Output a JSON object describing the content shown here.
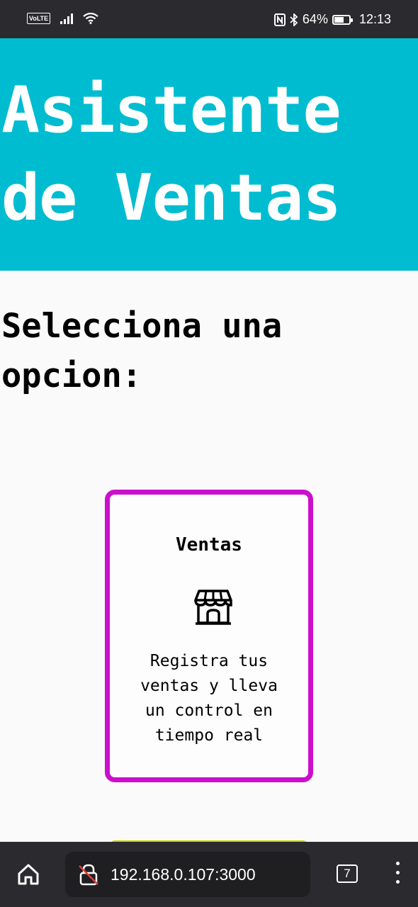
{
  "status_bar": {
    "volte": "VoLTE",
    "battery_percent": "64%",
    "battery_level": 0.64,
    "time": "12:13",
    "icons": [
      "volte-icon",
      "signal-icon",
      "wifi-icon",
      "nfc-icon",
      "bluetooth-icon",
      "battery-icon"
    ]
  },
  "header": {
    "title": "Asistente de Ventas",
    "background": "#00bcd0"
  },
  "main": {
    "prompt": "Selecciona una opcion:",
    "options": [
      {
        "title": "Ventas",
        "icon": "store-icon",
        "description": "Registra tus ventas y lleva un control en tiempo real",
        "border_color": "#cc0fcc"
      }
    ],
    "next_option_color": "#c8d400"
  },
  "browser": {
    "url": "192.168.0.107:3000",
    "tab_count": "7",
    "icons": [
      "home-icon",
      "insecure-lock-icon",
      "tabs-icon",
      "more-vert-icon"
    ]
  }
}
